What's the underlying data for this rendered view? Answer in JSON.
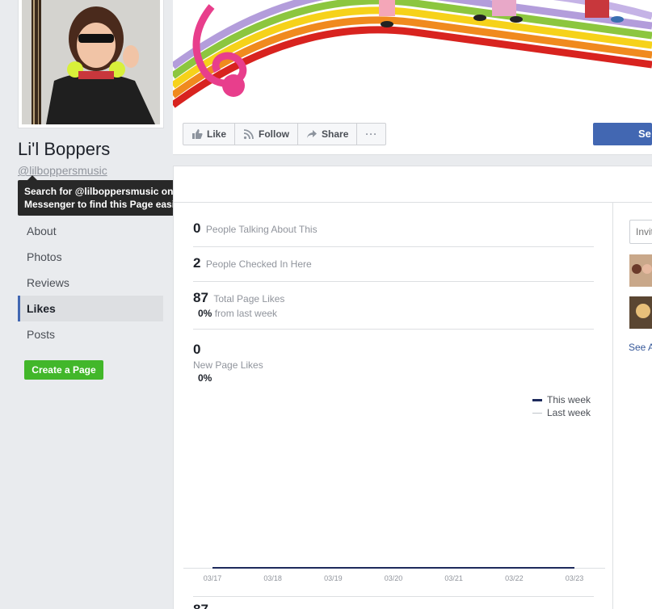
{
  "page": {
    "name": "Li'l Boppers",
    "username": "@lilboppersmusic",
    "tooltip": "Search for @lilboppersmusic on Facebook or in Messenger to find this Page easily."
  },
  "nav": {
    "items": [
      {
        "label": "About"
      },
      {
        "label": "Photos"
      },
      {
        "label": "Reviews"
      },
      {
        "label": "Likes"
      },
      {
        "label": "Posts"
      }
    ],
    "active": "Likes",
    "create_page": "Create a Page"
  },
  "actions": {
    "like": "Like",
    "follow": "Follow",
    "share": "Share",
    "more": "···",
    "send_partial": "Se"
  },
  "stats": {
    "talking": {
      "value": "0",
      "label": "People Talking About This"
    },
    "checked_in": {
      "value": "2",
      "label": "People Checked In Here"
    },
    "total_likes": {
      "value": "87",
      "label": "Total Page Likes",
      "change": "0%",
      "change_label": "from last week"
    },
    "new_likes": {
      "value": "0",
      "label": "New Page Likes",
      "change": "0%"
    }
  },
  "chart_data": {
    "type": "line",
    "x": [
      "03/17",
      "03/18",
      "03/19",
      "03/20",
      "03/21",
      "03/22",
      "03/23"
    ],
    "series": [
      {
        "name": "This week",
        "values": [
          0,
          0,
          0,
          0,
          0,
          0,
          0
        ],
        "color": "#1d2a5c"
      },
      {
        "name": "Last week",
        "values": [
          0,
          0,
          0,
          0,
          0,
          0,
          0
        ],
        "color": "#bec3c9"
      }
    ],
    "legend": "top-right"
  },
  "right_panel": {
    "invite_placeholder": "Invite",
    "see_all": "See All"
  },
  "bottom_number_partial": "87",
  "colors": {
    "accent": "#4267b2",
    "green": "#42b72a",
    "link": "#365899"
  }
}
